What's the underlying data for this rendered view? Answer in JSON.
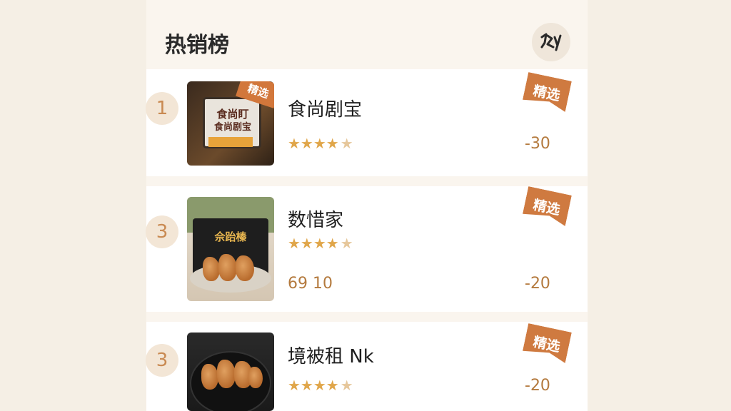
{
  "header": {
    "title": "热销榜",
    "icon": "signature-icon"
  },
  "items": [
    {
      "rank": "1",
      "name": "食尚剧宝",
      "image_text_1": "食尚盯",
      "image_text_2": "食尚剧宝",
      "image_tag": "精选",
      "featured_tag": "精选",
      "stars": "★★★★",
      "half_star": "★",
      "rating": 4.5,
      "price": "",
      "discount": "-30"
    },
    {
      "rank": "3",
      "name": "数惜家",
      "image_text_1": "佘跆榛",
      "featured_tag": "精选",
      "stars": "★★★★",
      "half_star": "★",
      "rating": 4.5,
      "price": "69 10",
      "discount": "-20"
    },
    {
      "rank": "3",
      "name": "境被租 Nk",
      "featured_tag": "精选",
      "stars": "★★★★",
      "half_star": "★",
      "rating": 4.5,
      "price": "",
      "discount": "-20"
    }
  ],
  "colors": {
    "accent": "#cf7a40",
    "star": "#e0a64a",
    "price": "#b47a3e"
  }
}
